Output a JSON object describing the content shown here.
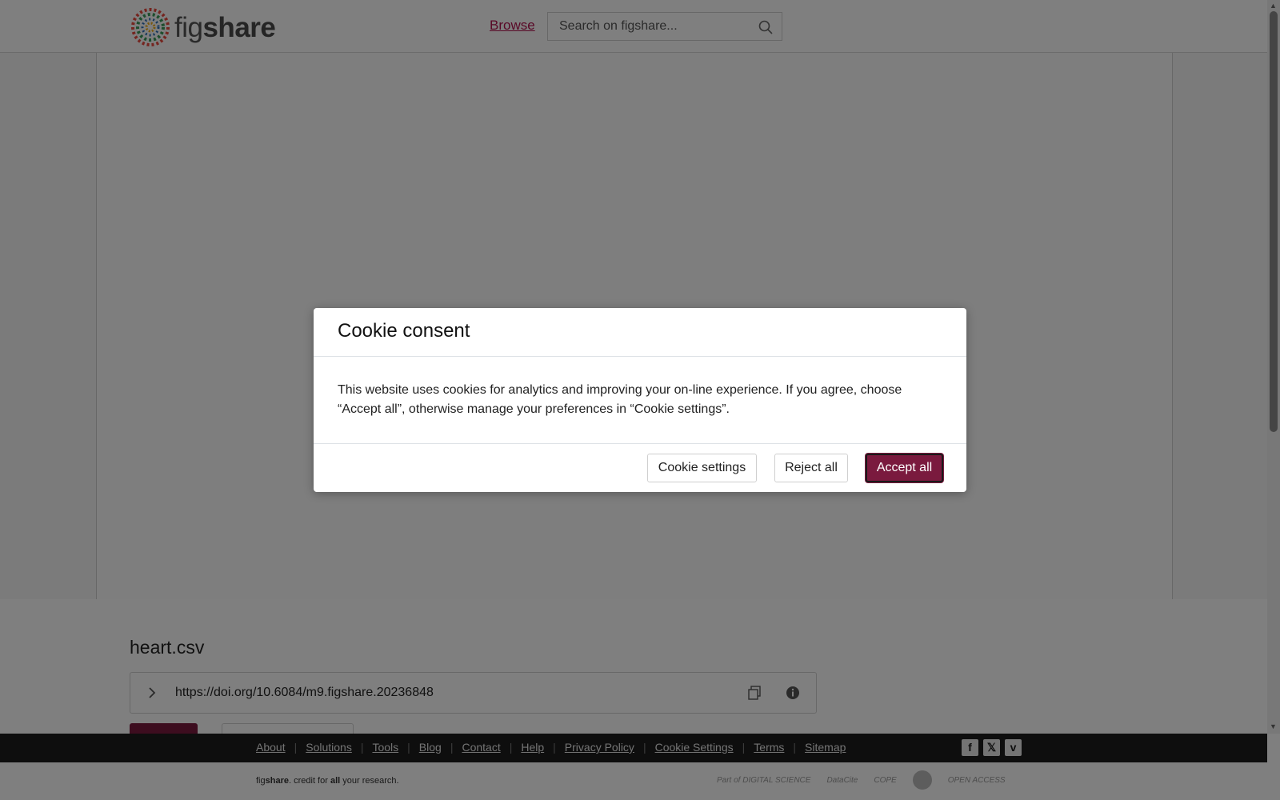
{
  "header": {
    "logo_fig": "fig",
    "logo_share": "share",
    "browse_label": "Browse",
    "search_placeholder": "Search on figshare..."
  },
  "file": {
    "title": "heart.csv",
    "doi": "https://doi.org/10.6084/m9.figshare.20236848"
  },
  "footer": {
    "links": [
      "About",
      "Solutions",
      "Tools",
      "Blog",
      "Contact",
      "Help",
      "Privacy Policy",
      "Cookie Settings",
      "Terms",
      "Sitemap"
    ],
    "tagline_fig": "fig",
    "tagline_share": "share",
    "tagline_mid": ". credit for ",
    "tagline_all": "all",
    "tagline_end": " your research.",
    "partner_digital_science": "Part of DIGITAL SCIENCE",
    "partner_datacite": "DataCite",
    "partner_cope": "COPE",
    "partner_open_access": "OPEN ACCESS"
  },
  "modal": {
    "title": "Cookie consent",
    "body": "This website uses cookies for analytics and improving your on-line experience. If you agree, choose “Accept all”, otherwise manage your preferences in “Cookie settings”.",
    "settings_label": "Cookie settings",
    "reject_label": "Reject all",
    "accept_label": "Accept all"
  },
  "colors": {
    "brand": "#7a1a3e",
    "link": "#b3124f",
    "footer_bg": "#1c1c1c"
  },
  "icons": {
    "search": "search-icon",
    "chevron": "chevron-right-icon",
    "copy": "copy-icon",
    "info": "info-icon",
    "facebook": "facebook-icon",
    "x": "x-icon",
    "vimeo": "vimeo-icon"
  }
}
